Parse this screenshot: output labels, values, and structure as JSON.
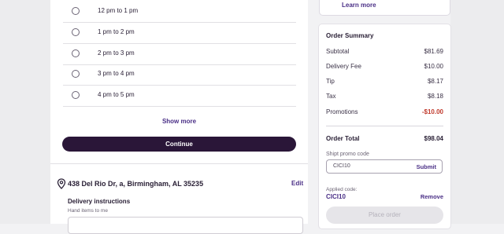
{
  "delivery_window": {
    "slots": [
      "12 pm to 1 pm",
      "1 pm to 2 pm",
      "2 pm to 3 pm",
      "3 pm to 4 pm",
      "4 pm to 5 pm"
    ],
    "show_more_label": "Show more",
    "continue_label": "Continue"
  },
  "address": {
    "text": "438 Del Rio Dr, a, Birmingham, AL 35235",
    "edit_label": "Edit",
    "instructions_title": "Delivery instructions",
    "instructions_text": "Hand items to me"
  },
  "info_card": {
    "learn_more_label": "Learn more"
  },
  "order_summary": {
    "title": "Order Summary",
    "rows": [
      {
        "label": "Subtotal",
        "value": "$81.69"
      },
      {
        "label": "Delivery Fee",
        "value": "$10.00"
      },
      {
        "label": "Tip",
        "value": "$8.17"
      },
      {
        "label": "Tax",
        "value": "$8.18"
      },
      {
        "label": "Promotions",
        "value": "-$10.00"
      }
    ],
    "total_label": "Order Total",
    "total_value": "$98.04",
    "promo_caption": "Shipt promo code",
    "promo_value": "CICI10",
    "submit_label": "Submit",
    "applied_caption": "Applied code:",
    "applied_code": "CICI10",
    "remove_label": "Remove",
    "place_order_label": "Place order"
  },
  "colors": {
    "accent": "#4a2f86",
    "dark_button": "#2a1638",
    "promotion": "#c0392b"
  }
}
